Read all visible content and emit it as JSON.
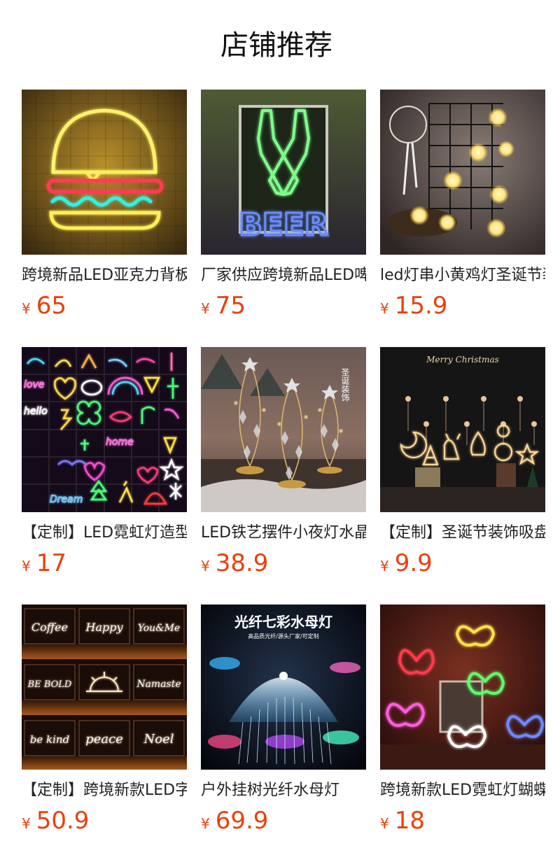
{
  "section": {
    "title": "店铺推荐"
  },
  "products": [
    {
      "name": "跨境新品LED亚克力背板汉堡霓虹灯",
      "currency": "¥",
      "price": "65",
      "image": "burger-neon-sign"
    },
    {
      "name": "厂家供应跨境新品LED啤酒霓虹灯",
      "currency": "¥",
      "price": "75",
      "image": "beer-bottle-neon-sign"
    },
    {
      "name": "led灯串小黄鸡灯圣诞节装饰",
      "currency": "¥",
      "price": "15.9",
      "image": "chick-string-lights"
    },
    {
      "name": "【定制】LED霓虹灯造型灯",
      "currency": "¥",
      "price": "17",
      "image": "neon-shapes-collage"
    },
    {
      "name": "LED铁艺摆件小夜灯水晶圣诞树",
      "currency": "¥",
      "price": "38.9",
      "image": "iron-christmas-tree-lamps"
    },
    {
      "name": "【定制】圣诞节装饰吸盘灯",
      "currency": "¥",
      "price": "9.9",
      "image": "christmas-window-lights"
    },
    {
      "name": "【定制】跨境新款LED字母霓虹灯",
      "currency": "¥",
      "price": "50.9",
      "image": "neon-word-signs"
    },
    {
      "name": "户外挂树光纤水母灯",
      "currency": "¥",
      "price": "69.9",
      "image": "fiber-jellyfish-lamp",
      "overlay": {
        "title": "光纤七彩水母灯",
        "subtitle": "高品质光纤/源头厂家/可定制"
      }
    },
    {
      "name": "跨境新款LED霓虹灯蝴蝶",
      "currency": "¥",
      "price": "18",
      "image": "butterfly-neon-lights"
    }
  ],
  "image_text": {
    "beer_word": "BEER",
    "merry_christmas": "Merry Christmas",
    "xmas_tag": "圣诞装饰",
    "neon_words": [
      "Coffee",
      "Happy",
      "You&Me",
      "BE BOLD",
      "Namaste",
      "be kind",
      "peace",
      "Noel"
    ],
    "collage_words": [
      "love",
      "hello",
      "home",
      "Dream"
    ]
  },
  "colors": {
    "price": "#e8410c",
    "title": "#111111",
    "name": "#222222"
  }
}
